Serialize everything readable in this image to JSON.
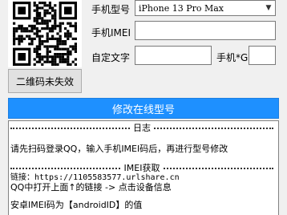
{
  "qr": {
    "status_button_label": "二维码未失效"
  },
  "form": {
    "model_label": "手机型号",
    "model_value": "iPhone 13 Pro Max",
    "imei_label": "手机IMEI",
    "imei_value": "",
    "custom_text_label": "自定文字",
    "custom_text_value": "",
    "gb_label": "手机*G",
    "gb_value": ""
  },
  "actions": {
    "modify_button_label": "修改在线型号"
  },
  "log": {
    "title": "日志",
    "line1": "请先扫码登录QQ，输入手机IMEI码后，再进行型号修改",
    "imei_section_title": "IMEI获取",
    "link_line": "链接：https://1105583577.urlshare.cn",
    "instruction_line": "QQ中打开上面↑的链接 -> 点击设备信息",
    "android_line": "安卓IMEI码为【androidID】的值"
  }
}
